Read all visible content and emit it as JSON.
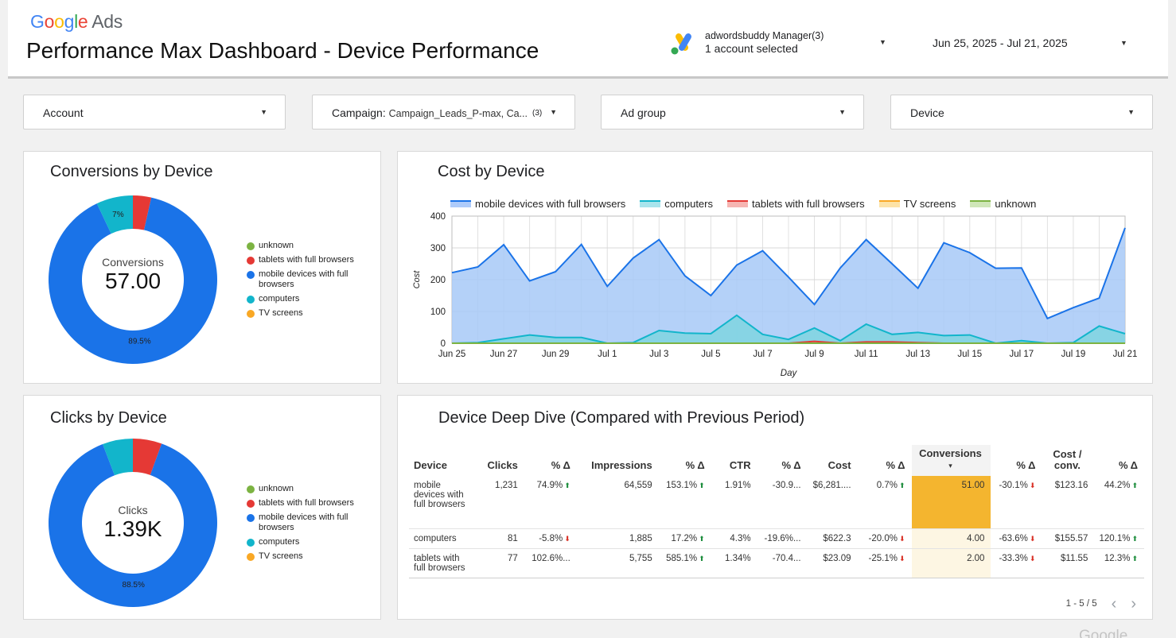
{
  "header": {
    "logo_google": "Google",
    "logo_ads": "Ads",
    "title": "Performance Max Dashboard - Device Performance",
    "account_name": "adwordsbuddy Manager(3)",
    "account_selected": "1 account selected",
    "date_range": "Jun 25, 2025 - Jul 21, 2025"
  },
  "filters": [
    {
      "label": "Account",
      "value": "",
      "count": ""
    },
    {
      "label": "Campaign",
      "value": "Campaign_Leads_P-max, Ca...",
      "count": "(3)"
    },
    {
      "label": "Ad group",
      "value": "",
      "count": ""
    },
    {
      "label": "Device",
      "value": "",
      "count": ""
    }
  ],
  "conversions_card": {
    "title": "Conversions by Device",
    "center_label": "Conversions",
    "center_value": "57.00",
    "legend": [
      "unknown",
      "tablets with full browsers",
      "mobile devices with full browsers",
      "computers",
      "TV screens"
    ]
  },
  "clicks_card": {
    "title": "Clicks by Device",
    "center_label": "Clicks",
    "center_value": "1.39K",
    "legend": [
      "unknown",
      "tablets with full browsers",
      "mobile devices with full browsers",
      "computers",
      "TV screens"
    ]
  },
  "cost_card": {
    "title": "Cost by Device",
    "legend": [
      "mobile devices with full browsers",
      "computers",
      "tablets with full browsers",
      "TV screens",
      "unknown"
    ]
  },
  "colors": {
    "unknown": "#7cb342",
    "tablets": "#e53935",
    "mobile": "#1a73e8",
    "computers": "#12b5cb",
    "tv": "#f9a825"
  },
  "chart_data": [
    {
      "type": "pie",
      "title": "Conversions by Device",
      "categories": [
        "mobile devices with full browsers",
        "computers",
        "tablets with full browsers",
        "TV screens",
        "unknown"
      ],
      "values": [
        51,
        4,
        2,
        0,
        0
      ],
      "labels": [
        "89.5%",
        "7%",
        "",
        "",
        ""
      ]
    },
    {
      "type": "pie",
      "title": "Clicks by Device",
      "categories": [
        "mobile devices with full browsers",
        "computers",
        "tablets with full browsers",
        "TV screens",
        "unknown"
      ],
      "values": [
        1231,
        81,
        77,
        0,
        0
      ],
      "labels": [
        "88.5%",
        "",
        "",
        "",
        ""
      ]
    },
    {
      "type": "area",
      "title": "Cost by Device",
      "xlabel": "Day",
      "ylabel": "Cost",
      "ylim": [
        0,
        400
      ],
      "yticks": [
        0,
        100,
        200,
        300,
        400
      ],
      "x": [
        "Jun 25",
        "Jun 26",
        "Jun 27",
        "Jun 28",
        "Jun 29",
        "Jun 30",
        "Jul 1",
        "Jul 2",
        "Jul 3",
        "Jul 4",
        "Jul 5",
        "Jul 6",
        "Jul 7",
        "Jul 8",
        "Jul 9",
        "Jul 10",
        "Jul 11",
        "Jul 12",
        "Jul 13",
        "Jul 14",
        "Jul 15",
        "Jul 16",
        "Jul 17",
        "Jul 18",
        "Jul 19",
        "Jul 20",
        "Jul 21"
      ],
      "xticks": [
        "Jun 25",
        "Jun 27",
        "Jun 29",
        "Jul 1",
        "Jul 3",
        "Jul 5",
        "Jul 7",
        "Jul 9",
        "Jul 11",
        "Jul 13",
        "Jul 15",
        "Jul 17",
        "Jul 19",
        "Jul 21"
      ],
      "series": [
        {
          "name": "mobile devices with full browsers",
          "values": [
            222,
            240,
            310,
            196,
            225,
            311,
            179,
            268,
            326,
            212,
            150,
            246,
            291,
            208,
            122,
            237,
            326,
            250,
            173,
            316,
            285,
            236,
            237,
            78,
            112,
            142,
            363
          ]
        },
        {
          "name": "computers",
          "values": [
            0,
            2,
            14,
            26,
            18,
            18,
            0,
            2,
            40,
            32,
            30,
            88,
            28,
            12,
            48,
            8,
            60,
            28,
            34,
            24,
            26,
            0,
            8,
            0,
            2,
            54,
            30
          ]
        },
        {
          "name": "tablets with full browsers",
          "values": [
            0,
            0,
            0,
            0,
            0,
            0,
            0,
            0,
            0,
            0,
            0,
            0,
            0,
            0,
            6,
            0,
            4,
            4,
            2,
            0,
            0,
            0,
            0,
            0,
            0,
            0,
            0
          ]
        },
        {
          "name": "TV screens",
          "values": [
            0,
            0,
            0,
            0,
            0,
            0,
            0,
            0,
            0,
            0,
            0,
            0,
            0,
            0,
            0,
            0,
            0,
            0,
            0,
            0,
            0,
            0,
            0,
            0,
            0,
            0,
            0
          ]
        },
        {
          "name": "unknown",
          "values": [
            0,
            0,
            0,
            0,
            0,
            0,
            0,
            0,
            0,
            0,
            0,
            0,
            0,
            0,
            0,
            0,
            0,
            0,
            0,
            0,
            0,
            0,
            0,
            0,
            0,
            0,
            0
          ]
        }
      ]
    }
  ],
  "deep_dive": {
    "title": "Device Deep Dive (Compared with Previous Period)",
    "columns": [
      "Device",
      "Clicks",
      "% Δ",
      "Impressions",
      "% Δ",
      "CTR",
      "% Δ",
      "Cost",
      "% Δ",
      "Conversions",
      "% Δ",
      "Cost / conv.",
      "% Δ"
    ],
    "sort_marker": "▾",
    "rows": [
      {
        "device": "mobile devices with full browsers",
        "clicks": "1,231",
        "clicks_d": "74.9%",
        "clicks_up": true,
        "impr": "64,559",
        "impr_d": "153.1%",
        "impr_up": true,
        "ctr": "1.91%",
        "ctr_d": "-30.9...",
        "ctr_up": null,
        "cost": "$6,281....",
        "cost_d": "0.7%",
        "cost_up": true,
        "conv": "51.00",
        "conv_d": "-30.1%",
        "conv_up": false,
        "cpc": "$123.16",
        "cpc_d": "44.2%",
        "cpc_up": true
      },
      {
        "device": "computers",
        "clicks": "81",
        "clicks_d": "-5.8%",
        "clicks_up": false,
        "impr": "1,885",
        "impr_d": "17.2%",
        "impr_up": true,
        "ctr": "4.3%",
        "ctr_d": "-19.6%...",
        "ctr_up": null,
        "cost": "$622.3",
        "cost_d": "-20.0%",
        "cost_up": false,
        "conv": "4.00",
        "conv_d": "-63.6%",
        "conv_up": false,
        "cpc": "$155.57",
        "cpc_d": "120.1%",
        "cpc_up": true
      },
      {
        "device": "tablets with full browsers",
        "clicks": "77",
        "clicks_d": "102.6%...",
        "clicks_up": null,
        "impr": "5,755",
        "impr_d": "585.1%",
        "impr_up": true,
        "ctr": "1.34%",
        "ctr_d": "-70.4...",
        "ctr_up": null,
        "cost": "$23.09",
        "cost_d": "-25.1%",
        "cost_up": false,
        "conv": "2.00",
        "conv_d": "-33.3%",
        "conv_up": false,
        "cpc": "$11.55",
        "cpc_d": "12.3%",
        "cpc_up": true
      }
    ],
    "pager": "1 - 5 / 5",
    "prev": "‹",
    "next": "›"
  },
  "watermark": "Google"
}
